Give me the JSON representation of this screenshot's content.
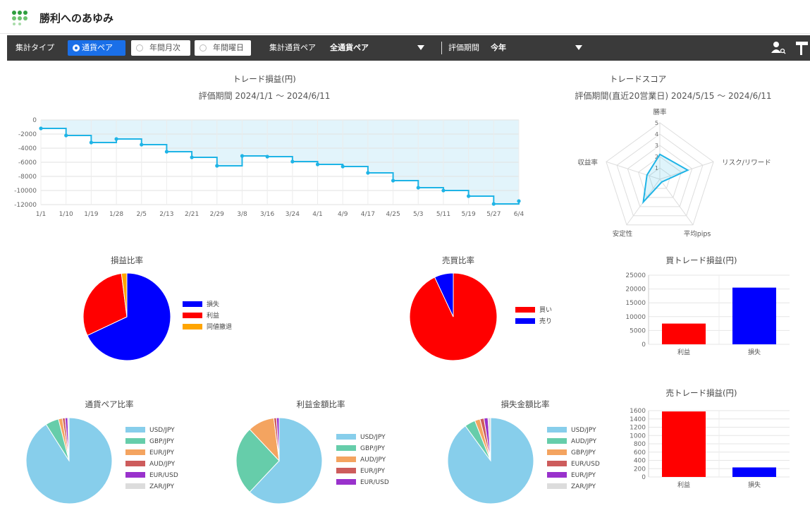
{
  "app": {
    "title": "勝利へのあゆみ"
  },
  "toolbar": {
    "aggregation_type_label": "集計タイプ",
    "buttons": [
      {
        "label": "通貨ペア",
        "active": true
      },
      {
        "label": "年間月次",
        "active": false
      },
      {
        "label": "年間曜日",
        "active": false
      }
    ],
    "pair_label": "集計通貨ペア",
    "pair_value": "全通貨ペア",
    "period_label": "評価期間",
    "period_value": "今年",
    "icons": [
      "user-search-icon",
      "paint-roller-icon"
    ]
  },
  "pnl_chart": {
    "title": "トレード損益(円)",
    "subtitle": "評価期間  2024/1/1 ～ 2024/6/11"
  },
  "score_chart": {
    "title": "トレードスコア",
    "subtitle": "評価期間(直近20営業日)  2024/5/15 ～ 2024/6/11"
  },
  "profit_loss_ratio": {
    "title": "損益比率"
  },
  "buy_sell_ratio": {
    "title": "売買比率"
  },
  "buy_trade_pnl": {
    "title": "買トレード損益(円)"
  },
  "pair_ratio": {
    "title": "通貨ペア比率"
  },
  "profit_amount_ratio": {
    "title": "利益金額比率"
  },
  "loss_amount_ratio": {
    "title": "損失金額比率"
  },
  "sell_trade_pnl": {
    "title": "売トレード損益(円)"
  },
  "colors": {
    "accent": "#1a6fe8",
    "toolbar": "#3a3a3a",
    "line": "#1fb4e6",
    "loss": "#0000ff",
    "profit": "#ff0000",
    "even": "#ffa500"
  },
  "chart_data": [
    {
      "id": "pnl_line",
      "type": "area",
      "title": "トレード損益(円)",
      "x": [
        "1/1",
        "1/10",
        "1/19",
        "1/28",
        "2/5",
        "2/13",
        "2/21",
        "2/29",
        "3/8",
        "3/16",
        "3/24",
        "4/1",
        "4/9",
        "4/17",
        "4/25",
        "5/3",
        "5/11",
        "5/19",
        "5/27",
        "6/4"
      ],
      "series": [
        {
          "values": [
            -1200,
            -2200,
            -3200,
            -2700,
            -3500,
            -4500,
            -5300,
            -6500,
            -5100,
            -5200,
            -5900,
            -6300,
            -6600,
            -7500,
            -8600,
            -9600,
            -10000,
            -10800,
            -11900,
            -11500
          ]
        }
      ],
      "yticks": [
        0,
        -2000,
        -4000,
        -6000,
        -8000,
        -10000,
        -12000
      ],
      "ylim": [
        -12000,
        0
      ],
      "grid": true
    },
    {
      "id": "score_radar",
      "type": "radar",
      "title": "トレードスコア",
      "categories": [
        "勝率",
        "リスク/リワード",
        "平均pips",
        "安定性",
        "収益率"
      ],
      "values": [
        2.2,
        2.6,
        0.3,
        2.5,
        1.2
      ],
      "ticks": [
        1,
        2,
        3,
        4,
        5
      ],
      "rmax": 5
    },
    {
      "id": "pl_pie",
      "type": "pie",
      "title": "損益比率",
      "labels": [
        "損失",
        "利益",
        "同値撤退"
      ],
      "values": [
        68,
        30,
        2
      ],
      "colors": [
        "#0000ff",
        "#ff0000",
        "#ffa500"
      ]
    },
    {
      "id": "bs_pie",
      "type": "pie",
      "title": "売買比率",
      "labels": [
        "買い",
        "売り"
      ],
      "values": [
        93,
        7
      ],
      "colors": [
        "#ff0000",
        "#0000ff"
      ]
    },
    {
      "id": "buy_bar",
      "type": "bar",
      "title": "買トレード損益(円)",
      "categories": [
        "利益",
        "損失"
      ],
      "values": [
        7500,
        20500
      ],
      "colors": [
        "#ff0000",
        "#0000ff"
      ],
      "yticks": [
        0,
        5000,
        10000,
        15000,
        20000,
        25000
      ],
      "ylim": [
        0,
        25000
      ]
    },
    {
      "id": "pair_pie",
      "type": "pie",
      "title": "通貨ペア比率",
      "labels": [
        "USD/JPY",
        "GBP/JPY",
        "EUR/JPY",
        "AUD/JPY",
        "EUR/USD",
        "ZAR/JPY"
      ],
      "values": [
        91,
        5,
        1.5,
        1,
        1,
        0.5
      ],
      "colors": [
        "#87ceeb",
        "#66cdaa",
        "#f4a460",
        "#cd5c5c",
        "#9932cc",
        "#dcdcdc"
      ]
    },
    {
      "id": "profit_pie",
      "type": "pie",
      "title": "利益金額比率",
      "labels": [
        "USD/JPY",
        "GBP/JPY",
        "AUD/JPY",
        "EUR/JPY",
        "EUR/USD"
      ],
      "values": [
        62,
        26,
        10,
        1,
        1
      ],
      "colors": [
        "#87ceeb",
        "#66cdaa",
        "#f4a460",
        "#cd5c5c",
        "#9932cc"
      ]
    },
    {
      "id": "loss_pie",
      "type": "pie",
      "title": "損失金額比率",
      "labels": [
        "USD/JPY",
        "AUD/JPY",
        "GBP/JPY",
        "EUR/USD",
        "EUR/JPY",
        "ZAR/JPY"
      ],
      "values": [
        90,
        4,
        2,
        1.5,
        1.5,
        1
      ],
      "colors": [
        "#87ceeb",
        "#66cdaa",
        "#f4a460",
        "#cd5c5c",
        "#9932cc",
        "#dcdcdc"
      ]
    },
    {
      "id": "sell_bar",
      "type": "bar",
      "title": "売トレード損益(円)",
      "categories": [
        "利益",
        "損失"
      ],
      "values": [
        1580,
        230
      ],
      "colors": [
        "#ff0000",
        "#0000ff"
      ],
      "yticks": [
        0,
        200,
        400,
        600,
        800,
        1000,
        1200,
        1400,
        1600
      ],
      "ylim": [
        0,
        1600
      ]
    }
  ]
}
